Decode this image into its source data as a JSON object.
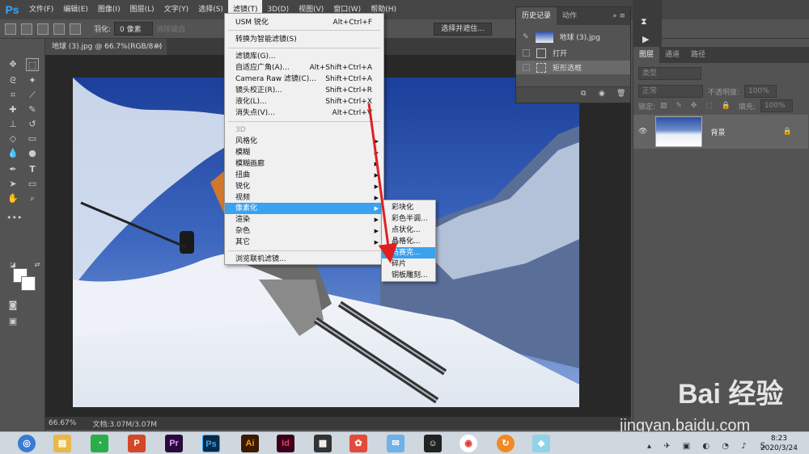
{
  "app": {
    "logo": "Ps"
  },
  "menubar": {
    "items": [
      "文件(F)",
      "编辑(E)",
      "图像(I)",
      "图层(L)",
      "文字(Y)",
      "选择(S)",
      "滤镜(T)",
      "3D(D)",
      "视图(V)",
      "窗口(W)",
      "帮助(H)"
    ],
    "active_index": 6
  },
  "options_bar": {
    "feather_label": "羽化:",
    "feather_value": "0 像素",
    "antialias_label": "消除锯齿",
    "select_mask_label": "选择并遮住..."
  },
  "document": {
    "tab_title": "地球 (3).jpg @ 66.7%(RGB/8#)",
    "zoom": "66.67%",
    "doc_size": "文档:3.07M/3.07M"
  },
  "filter_menu": {
    "items": [
      {
        "label": "USM 锐化",
        "shortcut": "Alt+Ctrl+F"
      },
      {
        "label": "转换为智能滤镜(S)"
      },
      {
        "label": "滤镜库(G)..."
      },
      {
        "label": "自适应广角(A)...",
        "shortcut": "Alt+Shift+Ctrl+A"
      },
      {
        "label": "Camera Raw 滤镜(C)...",
        "shortcut": "Shift+Ctrl+A"
      },
      {
        "label": "镜头校正(R)...",
        "shortcut": "Shift+Ctrl+R"
      },
      {
        "label": "液化(L)...",
        "shortcut": "Shift+Ctrl+X"
      },
      {
        "label": "消失点(V)...",
        "shortcut": "Alt+Ctrl+V"
      },
      {
        "label": "3D"
      },
      {
        "label": "风格化"
      },
      {
        "label": "模糊"
      },
      {
        "label": "模糊画廊"
      },
      {
        "label": "扭曲"
      },
      {
        "label": "锐化"
      },
      {
        "label": "视频"
      },
      {
        "label": "像素化"
      },
      {
        "label": "渲染"
      },
      {
        "label": "杂色"
      },
      {
        "label": "其它"
      },
      {
        "label": "浏览联机滤镜..."
      }
    ],
    "highlighted": "像素化"
  },
  "pixelate_submenu": {
    "items": [
      "彩块化",
      "彩色半调...",
      "点状化...",
      "晶格化...",
      "马赛克...",
      "碎片",
      "铜板雕刻..."
    ],
    "highlighted": "马赛克..."
  },
  "history_panel": {
    "tabs": [
      "历史记录",
      "动作"
    ],
    "snapshot": "地球 (3).jpg",
    "states": [
      "打开",
      "矩形选框"
    ]
  },
  "layers_panel": {
    "tabs": [
      "图层",
      "通道",
      "路径"
    ],
    "kind_label": "类型",
    "blend_mode": "正常",
    "opacity_label": "不透明度:",
    "opacity_value": "100%",
    "lock_label": "锁定:",
    "fill_label": "填充:",
    "fill_value": "100%",
    "layer_name": "背景"
  },
  "taskbar": {
    "apps": [
      "Pr",
      "Ps",
      "Ai",
      "Id"
    ],
    "time": "8:23",
    "date": "2020/3/24"
  },
  "watermark": {
    "text": "Bai 经验",
    "url": "jingyan.baidu.com"
  },
  "colors": {
    "accent": "#3aa2ee",
    "annotation_arrow": "#e02020"
  }
}
